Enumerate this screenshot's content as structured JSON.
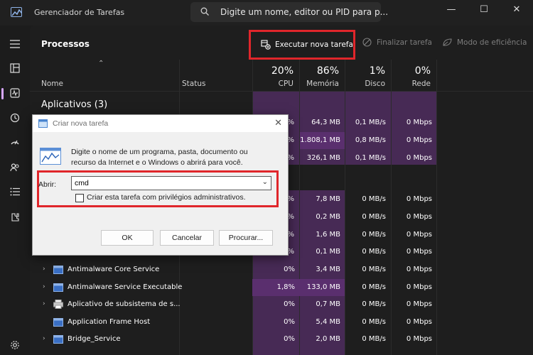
{
  "app": {
    "title": "Gerenciador de Tarefas",
    "search_placeholder": "Digite um nome, editor ou PID para p..."
  },
  "window_controls": {
    "minimize": "—",
    "maximize": "☐",
    "close": "✕"
  },
  "toolbar": {
    "section_title": "Processos",
    "run_new_task": "Executar nova tarefa",
    "end_task": "Finalizar tarefa",
    "efficiency_mode": "Modo de eficiência"
  },
  "table": {
    "col_name": "Nome",
    "col_status": "Status",
    "cpu": {
      "pct": "20%",
      "label": "CPU"
    },
    "memory": {
      "pct": "86%",
      "label": "Memória"
    },
    "disk": {
      "pct": "1%",
      "label": "Disco"
    },
    "network": {
      "pct": "0%",
      "label": "Rede"
    },
    "apps_section": "Aplicativos (3)",
    "rows_partial": [
      {
        "cpu": "%",
        "mem": "64,3 MB",
        "disk": "0,1 MB/s",
        "net": "0 Mbps"
      },
      {
        "cpu": "%",
        "mem": "1.808,1 MB",
        "disk": "0,8 MB/s",
        "net": "0 Mbps"
      },
      {
        "cpu": "%",
        "mem": "326,1 MB",
        "disk": "0,1 MB/s",
        "net": "0 Mbps"
      },
      {
        "cpu": "%",
        "mem": "7,8 MB",
        "disk": "0 MB/s",
        "net": "0 Mbps"
      },
      {
        "cpu": "%",
        "mem": "0,2 MB",
        "disk": "0 MB/s",
        "net": "0 Mbps"
      },
      {
        "cpu": "%",
        "mem": "1,6 MB",
        "disk": "0 MB/s",
        "net": "0 Mbps"
      },
      {
        "cpu": "%",
        "mem": "0,1 MB",
        "disk": "0 MB/s",
        "net": "0 Mbps"
      }
    ],
    "rows": [
      {
        "name": "Antimalware Core Service",
        "cpu": "0%",
        "mem": "3,4 MB",
        "disk": "0 MB/s",
        "net": "0 Mbps"
      },
      {
        "name": "Antimalware Service Executable",
        "cpu": "1,8%",
        "mem": "133,0 MB",
        "disk": "0 MB/s",
        "net": "0 Mbps"
      },
      {
        "name": "Aplicativo de subsistema de s...",
        "cpu": "0%",
        "mem": "0,7 MB",
        "disk": "0 MB/s",
        "net": "0 Mbps"
      },
      {
        "name": "Application Frame Host",
        "cpu": "0%",
        "mem": "5,4 MB",
        "disk": "0 MB/s",
        "net": "0 Mbps"
      },
      {
        "name": "Bridge_Service",
        "cpu": "0%",
        "mem": "2,0 MB",
        "disk": "0 MB/s",
        "net": "0 Mbps"
      }
    ]
  },
  "dialog": {
    "title": "Criar nova tarefa",
    "message": "Digite o nome de um programa, pasta, documento ou recurso da Internet e o Windows o abrirá para você.",
    "open_label": "Abrir:",
    "open_value": "cmd",
    "admin_checkbox": "Criar esta tarefa com privilégios administrativos.",
    "ok": "OK",
    "cancel": "Cancelar",
    "browse": "Procurar..."
  }
}
